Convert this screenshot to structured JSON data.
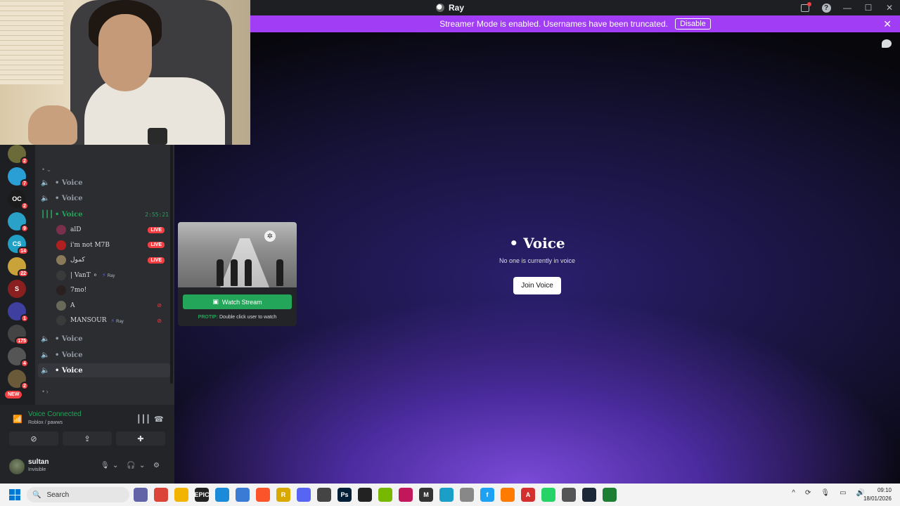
{
  "window": {
    "title": "Ray"
  },
  "banner": {
    "text": "Streamer Mode is enabled. Usernames have been truncated.",
    "disable_label": "Disable",
    "color": "#a13ef5"
  },
  "stage": {
    "title": "• Voice",
    "subtitle": "No one is currently in voice",
    "join_label": "Join Voice"
  },
  "servers": [
    {
      "badge": "2",
      "color": "#6b6b3a"
    },
    {
      "badge": "7",
      "color": "#2a9fd6"
    },
    {
      "badge": "2",
      "color": "#1b1b1b",
      "label": "OC"
    },
    {
      "badge": "9",
      "color": "#2aa1c9"
    },
    {
      "badge": "14",
      "color": "#1fa0c4",
      "label": "CS"
    },
    {
      "badge": "22",
      "color": "#c9a23a"
    },
    {
      "badge": "",
      "color": "#8a1f1f",
      "label": "S"
    },
    {
      "badge": "1",
      "color": "#3f3fa0"
    },
    {
      "badge": "175",
      "color": "#444444"
    },
    {
      "badge": "4",
      "color": "#555555"
    },
    {
      "badge": "2",
      "color": "#6a5a3a"
    }
  ],
  "new_label": "NEW",
  "channels": {
    "voice1": "• Voice",
    "voice2": "• Voice",
    "active": {
      "name": "• Voice",
      "timer": "2:55:21"
    },
    "users": [
      {
        "name": "alD",
        "live": "LIVE",
        "color": "#7a2f4a"
      },
      {
        "name": "i'm not M7B",
        "live": "LIVE",
        "color": "#b02020"
      },
      {
        "name": "كمول",
        "live": "LIVE",
        "color": "#8a7a5a"
      },
      {
        "name": "| VanT ⚬",
        "tag": "Ray",
        "color": "#3a3a3a"
      },
      {
        "name": "7mo!",
        "color": "#2a2020"
      },
      {
        "name": "A",
        "muted": true,
        "color": "#6a6a5a"
      },
      {
        "name": "MANSOUR",
        "tag": "Ray",
        "muted": true,
        "color": "#3a3a3a"
      }
    ],
    "voice4": "• Voice",
    "voice5": "• Voice",
    "voice6": "• Voice"
  },
  "popup": {
    "watch_label": "Watch Stream",
    "protip_label": "PROTIP:",
    "protip_text": "Double click user to watch"
  },
  "voice_panel": {
    "status": "Voice Connected",
    "location": "Roblox / pawws"
  },
  "user_panel": {
    "name": "sultan",
    "status": "Invisible"
  },
  "taskbar": {
    "search_label": "Search",
    "time": "09:10",
    "date": "18/01/2026",
    "apps": [
      {
        "label": "",
        "color": "#6264a7"
      },
      {
        "label": "",
        "color": "#db4437"
      },
      {
        "label": "",
        "color": "#f2b400"
      },
      {
        "label": "EPIC",
        "color": "#222222"
      },
      {
        "label": "",
        "color": "#1b8ad8"
      },
      {
        "label": "",
        "color": "#3a7bd5"
      },
      {
        "label": "",
        "color": "#fb542b"
      },
      {
        "label": "R",
        "color": "#d9a900"
      },
      {
        "label": "",
        "color": "#5865f2"
      },
      {
        "label": "",
        "color": "#444444"
      },
      {
        "label": "Ps",
        "color": "#001e36"
      },
      {
        "label": "",
        "color": "#222222"
      },
      {
        "label": "",
        "color": "#76b900"
      },
      {
        "label": "",
        "color": "#c2185b"
      },
      {
        "label": "M",
        "color": "#333333"
      },
      {
        "label": "",
        "color": "#1aa0c8"
      },
      {
        "label": "",
        "color": "#888888"
      },
      {
        "label": "f",
        "color": "#1da1f2"
      },
      {
        "label": "",
        "color": "#ff7a00"
      },
      {
        "label": "A",
        "color": "#d32f2f"
      },
      {
        "label": "",
        "color": "#25d366"
      },
      {
        "label": "",
        "color": "#555555"
      },
      {
        "label": "",
        "color": "#1b2838"
      },
      {
        "label": "",
        "color": "#1e7e34"
      }
    ]
  }
}
